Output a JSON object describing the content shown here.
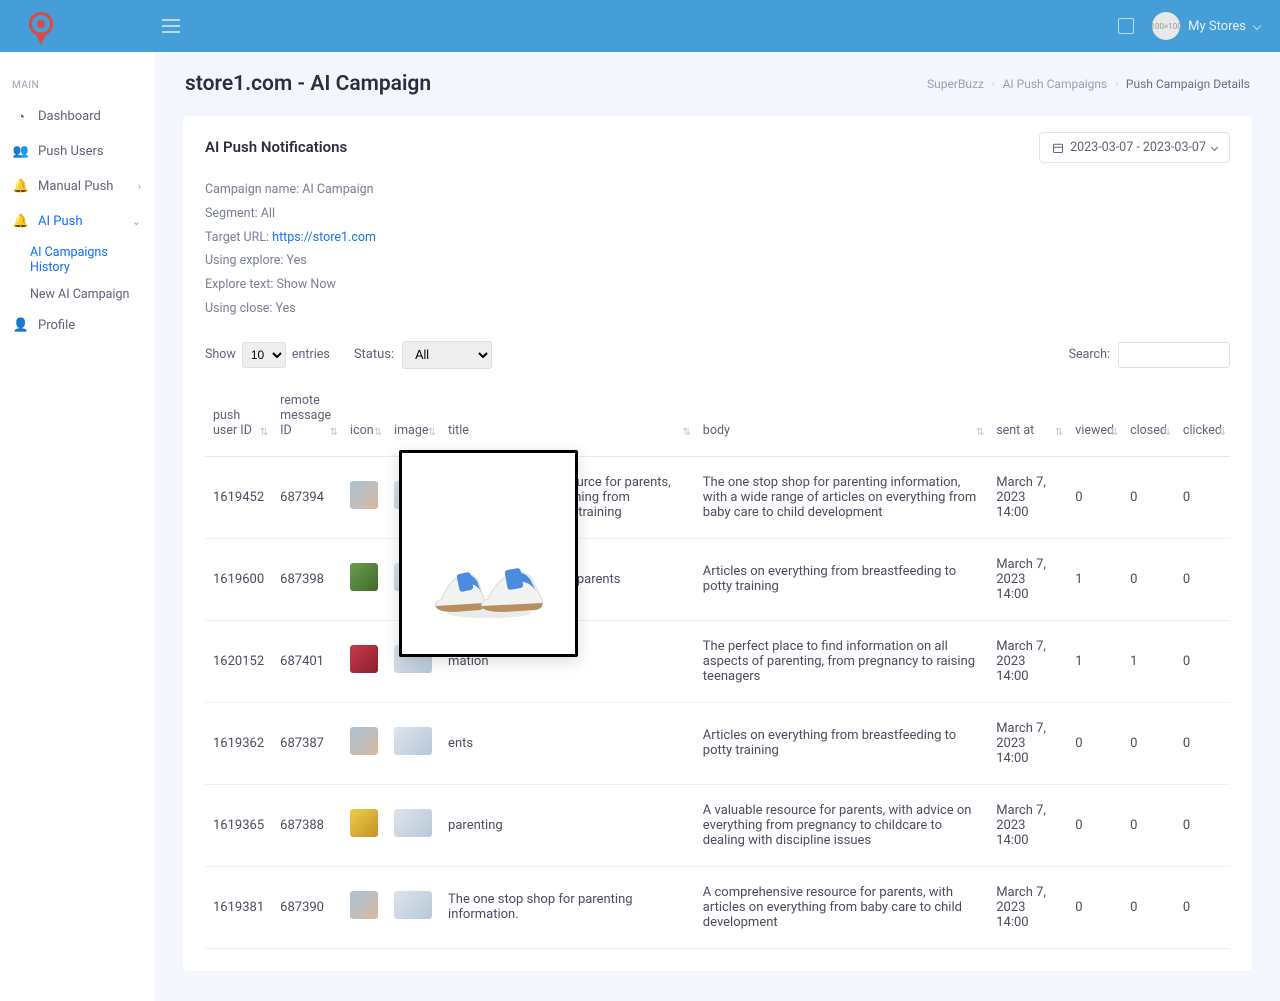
{
  "topbar": {
    "user_label": "My Stores"
  },
  "sidebar": {
    "section_main": "MAIN",
    "items": {
      "dashboard": "Dashboard",
      "push_users": "Push Users",
      "manual_push": "Manual Push",
      "ai_push": "AI Push",
      "ai_campaigns_history": "AI Campaigns History",
      "new_ai_campaign": "New AI Campaign",
      "profile": "Profile"
    }
  },
  "heading": {
    "title": "store1.com - AI Campaign"
  },
  "breadcrumb": {
    "a": "SuperBuzz",
    "b": "AI Push Campaigns",
    "c": "Push Campaign Details"
  },
  "card": {
    "title": "AI Push Notifications",
    "daterange": "2023-03-07 - 2023-03-07"
  },
  "meta": {
    "campaign": "Campaign name: AI Campaign",
    "segment": "Segment: All",
    "target_label": "Target URL: ",
    "target_url": "https://store1.com",
    "explore": "Using explore: Yes",
    "explore_text": "Explore text: Show Now",
    "close": "Using close: Yes"
  },
  "controls": {
    "show": "Show",
    "entries": "entries",
    "entries_value": "10",
    "status_label": "Status:",
    "status_value": "All",
    "search_label": "Search:",
    "search_value": ""
  },
  "table": {
    "headers": {
      "push_user_id": "push user ID",
      "remote_msg_id": "remote message ID",
      "icon": "icon",
      "image": "image",
      "title": "title",
      "body": "body",
      "sent_at": "sent at",
      "viewed": "viewed",
      "closed": "closed",
      "clicked": "clicked"
    },
    "rows": [
      {
        "pid": "1619452",
        "mid": "687394",
        "title": "A comprehensive resource for parents, with articles on everything from breastfeeding to potty training",
        "body": "The one stop shop for parenting information, with a wide range of articles on everything from baby care to child development",
        "sent": "March 7, 2023 14:00",
        "viewed": "0",
        "closed": "0",
        "clicked": "0"
      },
      {
        "pid": "1619600",
        "mid": "687398",
        "title": "An essential guide for parents",
        "body": "Articles on everything from breastfeeding to potty training",
        "sent": "March 7, 2023 14:00",
        "viewed": "1",
        "closed": "0",
        "clicked": "0"
      },
      {
        "pid": "1620152",
        "mid": "687401",
        "title": "mation",
        "body": "The perfect place to find information on all aspects of parenting, from pregnancy to raising teenagers",
        "sent": "March 7, 2023 14:00",
        "viewed": "1",
        "closed": "1",
        "clicked": "0"
      },
      {
        "pid": "1619362",
        "mid": "687387",
        "title": "ents",
        "body": "Articles on everything from breastfeeding to potty training",
        "sent": "March 7, 2023 14:00",
        "viewed": "0",
        "closed": "0",
        "clicked": "0"
      },
      {
        "pid": "1619365",
        "mid": "687388",
        "title": "parenting",
        "body": "A valuable resource for parents, with advice on everything from pregnancy to childcare to dealing with discipline issues",
        "sent": "March 7, 2023 14:00",
        "viewed": "0",
        "closed": "0",
        "clicked": "0"
      },
      {
        "pid": "1619381",
        "mid": "687390",
        "title": "The one stop shop for parenting information.",
        "body": "A comprehensive resource for parents, with articles on everything from baby care to child development",
        "sent": "March 7, 2023 14:00",
        "viewed": "0",
        "closed": "0",
        "clicked": "0"
      }
    ]
  }
}
